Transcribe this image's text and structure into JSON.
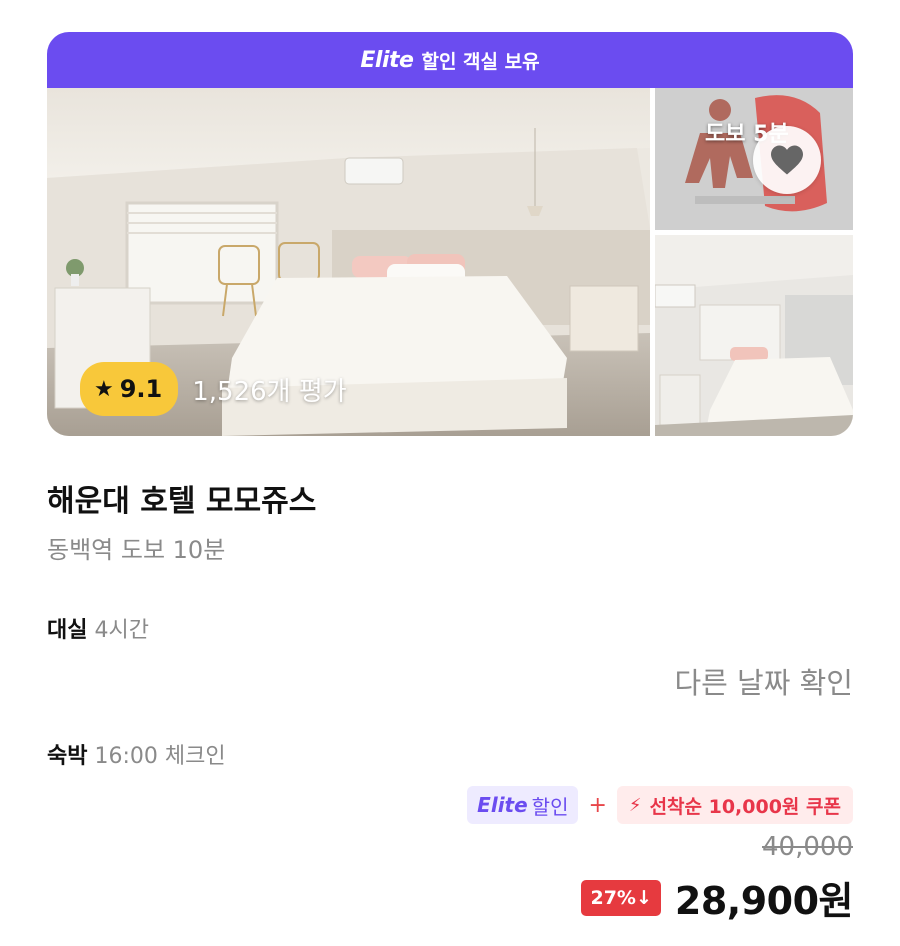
{
  "banner": {
    "elite": "Elite",
    "text": "할인 객실 보유"
  },
  "gallery": {
    "rating": "9.1",
    "review_count": "1,526개 평가",
    "top_photo_label": "도보 5분"
  },
  "hotel": {
    "name": "해운대 호텔 모모쥬스",
    "location": "동백역 도보 10분"
  },
  "daysil": {
    "label": "대실",
    "value": "4시간"
  },
  "other_date": "다른 날짜 확인",
  "stay": {
    "label": "숙박",
    "value": "16:00 체크인"
  },
  "promo": {
    "elite": "Elite",
    "elite_text": "할인",
    "plus": "+",
    "coupon": "선착순 10,000원 쿠폰"
  },
  "price": {
    "original": "40,000",
    "discount": "27%↓",
    "final": "28,900원"
  },
  "colors": {
    "accent": "#6b4cf0",
    "rating": "#f8c83a",
    "sale": "#e63a3f"
  },
  "icons": [
    "star-icon",
    "heart-icon",
    "bolt-icon"
  ]
}
